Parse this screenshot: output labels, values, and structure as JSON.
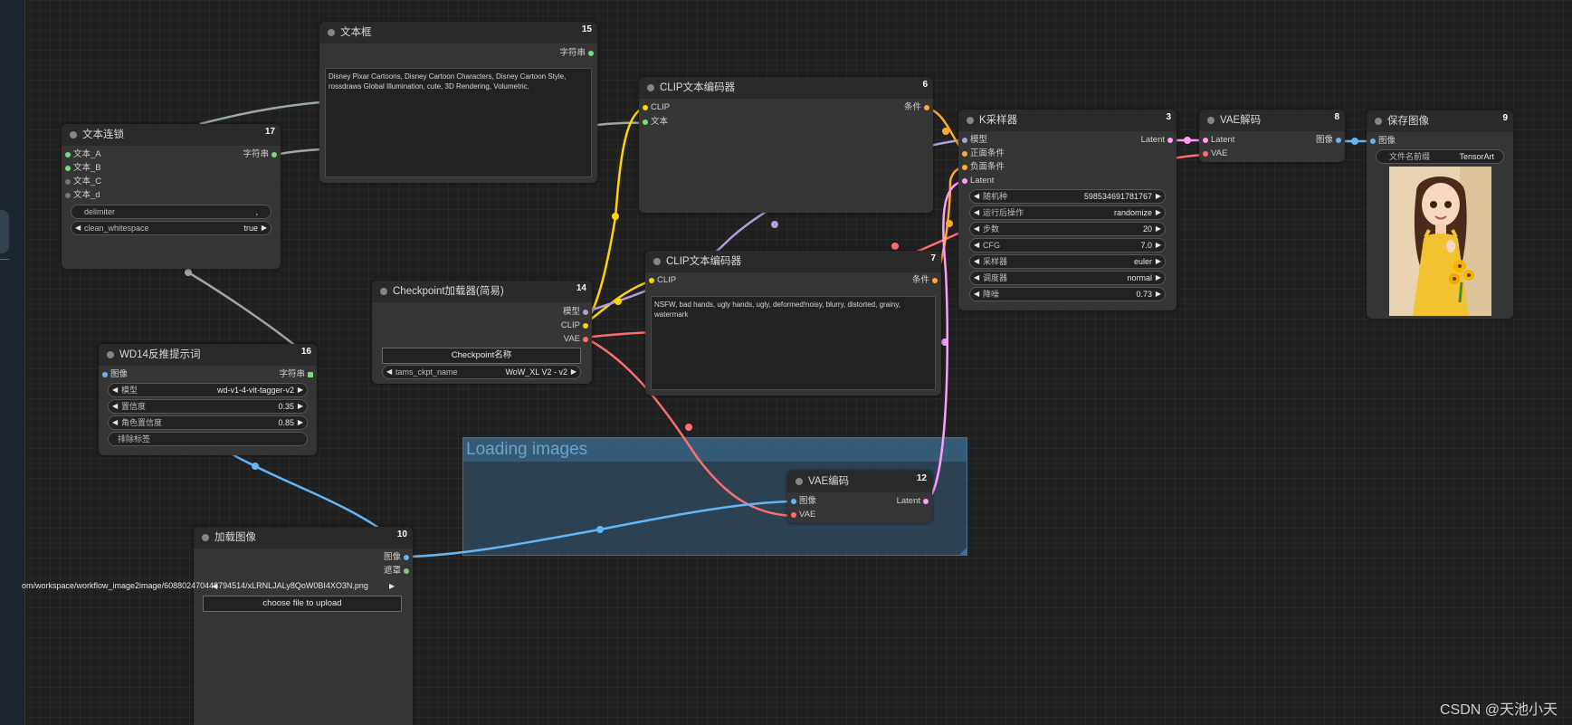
{
  "colors": {
    "string": "#77dd77",
    "clip": "#ffd500",
    "vae": "#ff6e6e",
    "conditioning": "#ffa931",
    "model": "#b39ddb",
    "latent": "#ff9cf9",
    "image": "#64b5f6",
    "mask": "#81c784"
  },
  "nodes": {
    "text_box": {
      "title": "文本框",
      "id": "15",
      "out_string": "字符串",
      "text": "Disney Pixar Cartoons, Disney Cartoon Characters, Disney Cartoon Style, rossdraws Global Illumination, cute, 3D Rendering, Volumetric,"
    },
    "text_concat": {
      "title": "文本连锁",
      "id": "17",
      "in_a": "文本_A",
      "in_b": "文本_B",
      "in_c": "文本_C",
      "in_d": "文本_d",
      "out_string": "字符串",
      "delimiter_label": "delimiter",
      "delimiter_value": ",",
      "clean_label": "clean_whitespace",
      "clean_value": "true"
    },
    "clip_pos": {
      "title": "CLIP文本编码器",
      "id": "6",
      "in_clip": "CLIP",
      "in_text": "文本",
      "out_cond": "条件"
    },
    "clip_neg": {
      "title": "CLIP文本编码器",
      "id": "7",
      "in_clip": "CLIP",
      "out_cond": "条件",
      "text": "NSFW, bad hands, ugly hands, ugly, deformed!noisy, blurry, distorted, grainy, watermark"
    },
    "ksampler": {
      "title": "K采样器",
      "id": "3",
      "in_model": "模型",
      "in_pos": "正面条件",
      "in_neg": "负面条件",
      "in_latent": "Latent",
      "out_latent": "Latent",
      "widgets": [
        {
          "label": "随机种",
          "value": "598534691781767"
        },
        {
          "label": "运行后操作",
          "value": "randomize"
        },
        {
          "label": "步数",
          "value": "20"
        },
        {
          "label": "CFG",
          "value": "7.0"
        },
        {
          "label": "采样器",
          "value": "euler"
        },
        {
          "label": "调度器",
          "value": "normal"
        },
        {
          "label": "降噪",
          "value": "0.73"
        }
      ]
    },
    "vae_decode": {
      "title": "VAE解码",
      "id": "8",
      "in_latent": "Latent",
      "in_vae": "VAE",
      "out_image": "图像"
    },
    "save_image": {
      "title": "保存图像",
      "id": "9",
      "in_image": "图像",
      "prefix_label": "文件名前缀",
      "prefix_value": "TensorArt"
    },
    "checkpoint": {
      "title": "Checkpoint加载器(简易)",
      "id": "14",
      "out_model": "模型",
      "out_clip": "CLIP",
      "out_vae": "VAE",
      "button_label": "Checkpoint名称",
      "ckpt_label": "tams_ckpt_name",
      "ckpt_value": "WoW_XL V2 -  v2"
    },
    "wd14": {
      "title": "WD14反推提示词",
      "id": "16",
      "in_image": "图像",
      "out_string": "字符串",
      "widgets": [
        {
          "label": "模型",
          "value": "wd-v1-4-vit-tagger-v2"
        },
        {
          "label": "置信度",
          "value": "0.35"
        },
        {
          "label": "角色置信度",
          "value": "0.85"
        }
      ],
      "exclude_label": "排除标签"
    },
    "vae_encode": {
      "title": "VAE编码",
      "id": "12",
      "in_image": "图像",
      "in_vae": "VAE",
      "out_latent": "Latent"
    },
    "load_image": {
      "title": "加载图像",
      "id": "10",
      "out_image": "图像",
      "out_mask": "遮罩",
      "file_value": "om/workspace/workflow_image2image/608802470448794514/xLRNLJALy8QoW0BI4XO3N.png",
      "upload_label": "choose file to upload"
    }
  },
  "group": {
    "title": "Loading images"
  },
  "watermark": "CSDN @天池小天"
}
